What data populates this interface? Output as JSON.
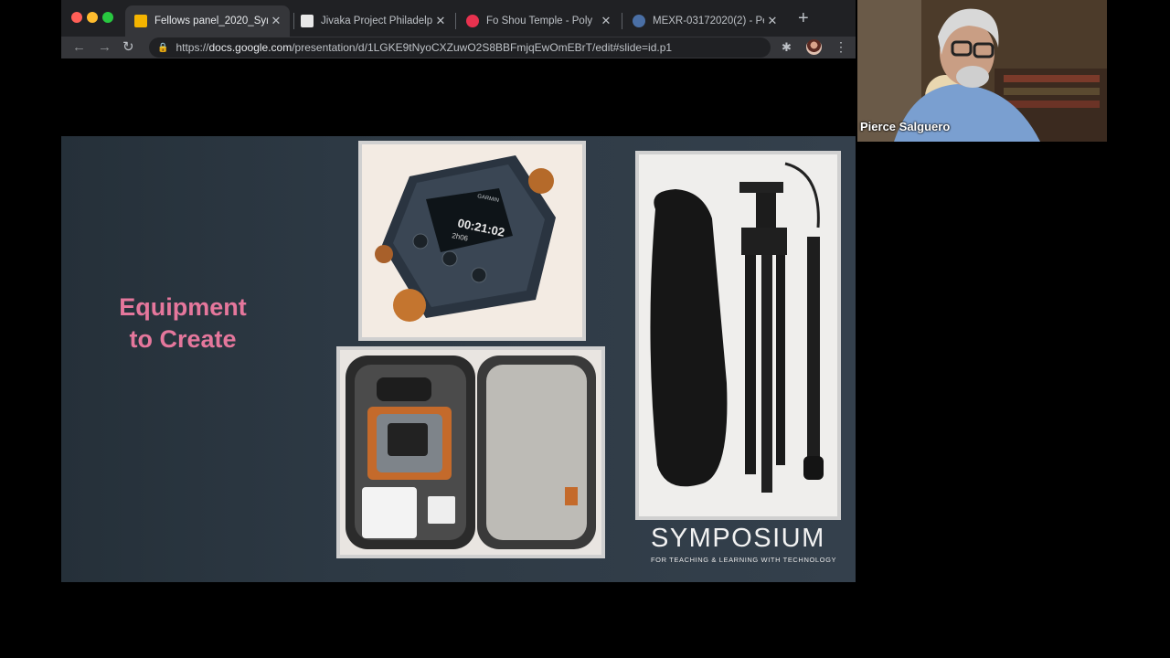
{
  "browser": {
    "tabs": [
      {
        "title": "Fellows panel_2020_Symp",
        "active": true
      },
      {
        "title": "Jivaka Project Philadelphi",
        "active": false
      },
      {
        "title": "Fo Shou Temple - Poly",
        "active": false
      },
      {
        "title": "MEXR-03172020(2) - Per",
        "active": false
      }
    ],
    "new_tab": "+",
    "url_host": "docs.google.com",
    "url_path": "/presentation/d/1LGKE9tNyoCXZuwO2S8BBFmjqEwOmEBrT/edit#slide=id.p1",
    "url_scheme": "https://"
  },
  "slide": {
    "title_line1": "Equipment",
    "title_line2": "to Create",
    "title_color": "#e5779c",
    "camera_screen_time": "00:21:02",
    "camera_screen_sub": "2h06",
    "camera_brand": "GARMIN",
    "logo_main": "SYMPOSIUM",
    "logo_sub": "FOR TEACHING & LEARNING WITH TECHNOLOGY"
  },
  "video": {
    "participant_name": "Pierce Salguero"
  },
  "icons": [
    "back-icon",
    "forward-icon",
    "reload-icon",
    "lock-icon",
    "extensions-icon",
    "profile-avatar",
    "menu-icon"
  ]
}
